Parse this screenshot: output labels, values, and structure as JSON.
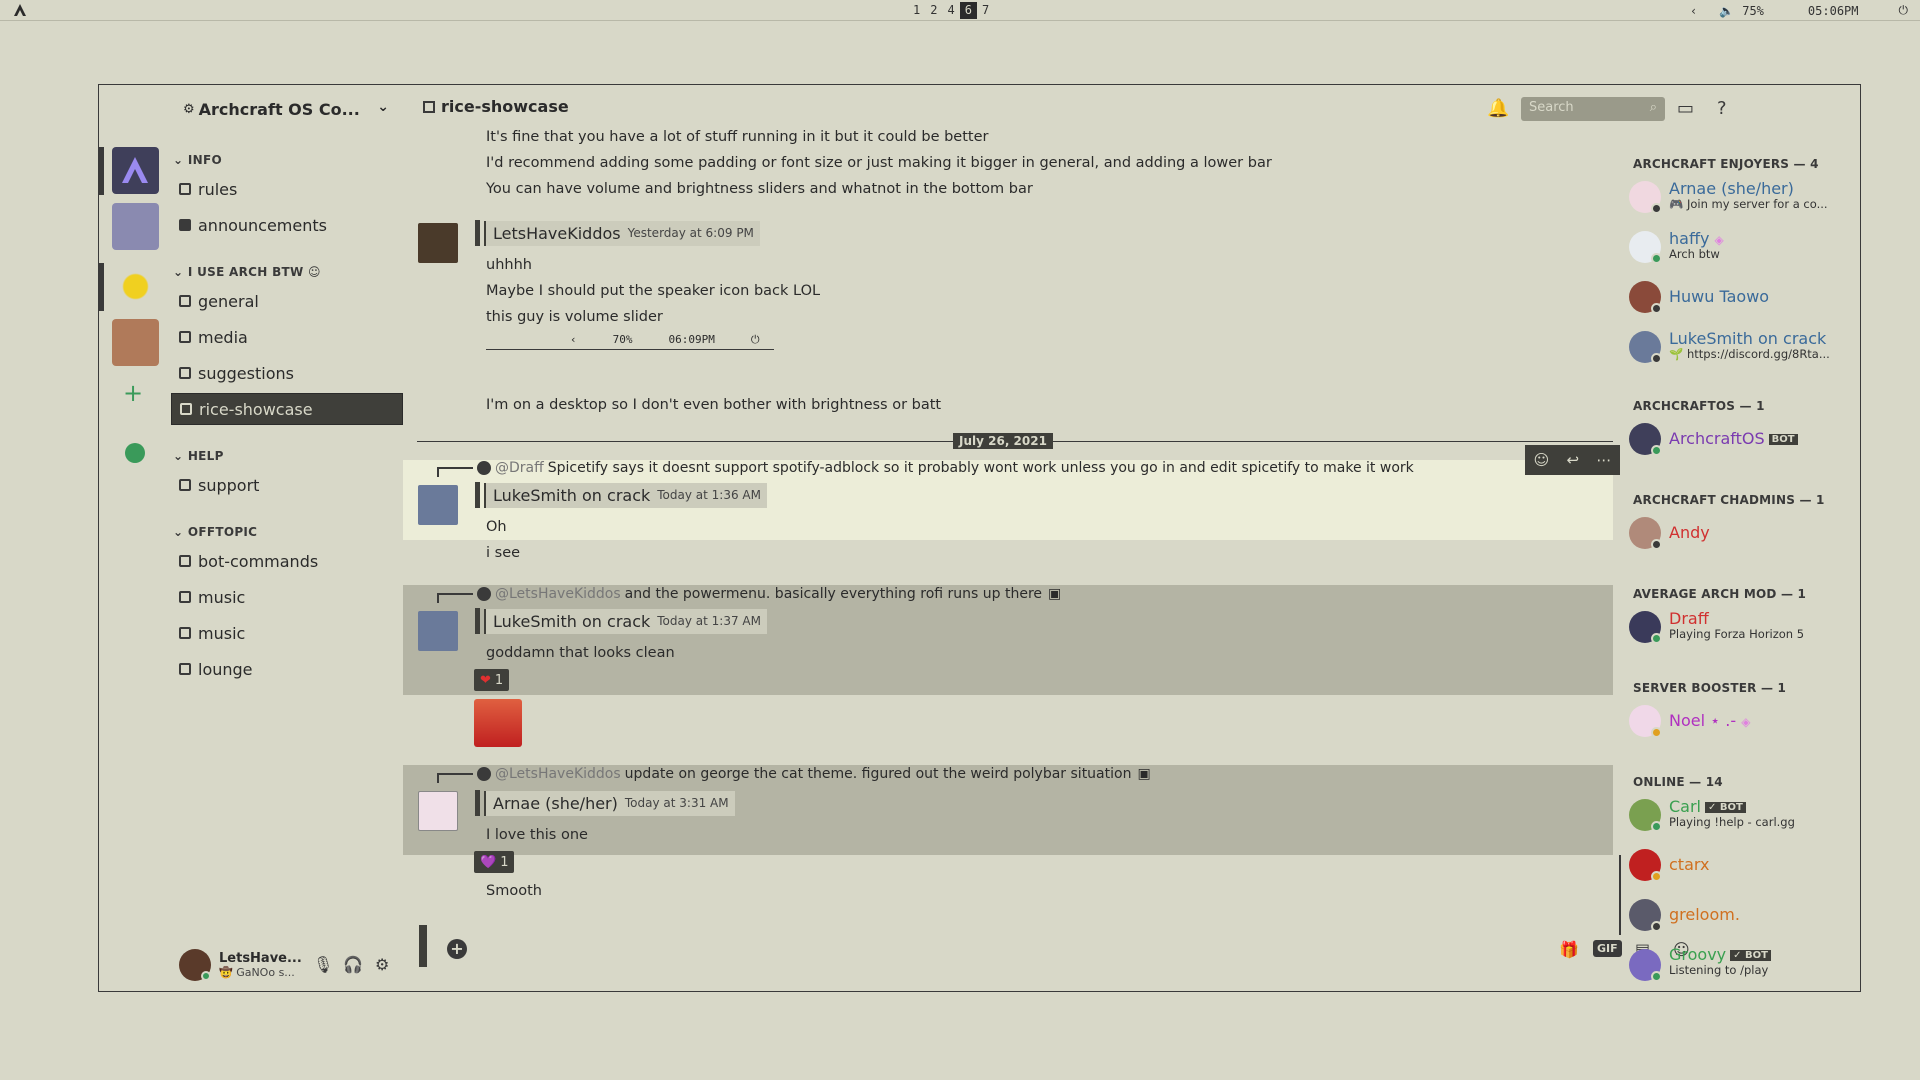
{
  "colors": {
    "background": "#d8d8c8",
    "dark": "#3f3f3a",
    "highlight": "#ecedd8",
    "selected_msg": "#b4b4a4",
    "online": "#3a9a5a",
    "idle": "#e0a020",
    "dnd": "#d03030"
  },
  "topbar": {
    "workspaces": [
      "1",
      "2",
      "4",
      "6",
      "7"
    ],
    "active_workspace": "6",
    "back_icon": "chevron-left-icon",
    "volume_icon": "speaker-icon",
    "volume": "75%",
    "time": "05:06PM",
    "power_icon": "power-icon"
  },
  "server": {
    "name": "Archcraft OS Co...",
    "categories": [
      {
        "label": "INFO"
      },
      {
        "label": "I USE ARCH BTW ☺"
      },
      {
        "label": "HELP"
      },
      {
        "label": "OFFTOPIC"
      }
    ],
    "channels": [
      {
        "label": "rules"
      },
      {
        "label": "announcements"
      },
      {
        "label": "general"
      },
      {
        "label": "media"
      },
      {
        "label": "suggestions"
      },
      {
        "label": "rice-showcase"
      },
      {
        "label": "support"
      },
      {
        "label": "bot-commands"
      },
      {
        "label": "music"
      },
      {
        "label": "music"
      },
      {
        "label": "lounge"
      }
    ]
  },
  "user": {
    "name": "LetsHave...",
    "status": "🤠 GaNOo s..."
  },
  "chat": {
    "channel": "rice-showcase",
    "search_placeholder": "Search",
    "date_divider": "July 26, 2021",
    "messages": [
      {
        "text": "It's fine that you have a lot of stuff running in it but it could be better"
      },
      {
        "text": "I'd recommend adding some padding or font size or just making it bigger in general, and adding a lower bar"
      },
      {
        "text": "You can have volume and brightness sliders and whatnot in the bottom bar"
      },
      {
        "author": "LetsHaveKiddos",
        "time": "Yesterday at 6:09 PM"
      },
      {
        "text": "uhhhh"
      },
      {
        "text": "Maybe I should put the speaker icon back LOL"
      },
      {
        "text": "this guy is volume slider"
      },
      {
        "text": "I'm on a desktop so I don't even bother with brightness or batt"
      }
    ],
    "embedded_bar": {
      "arrow": "‹",
      "volume": "70%",
      "time": "06:09PM",
      "power": "⏻"
    },
    "thread1": {
      "reply_mention": "@Draff",
      "reply_text": "Spicetify says it doesnt support spotify-adblock so it probably wont work unless you go in and edit spicetify to make it work",
      "author": "LukeSmith on crack",
      "time": "Today at 1:36 AM",
      "lines": [
        "Oh",
        "i see"
      ]
    },
    "thread2": {
      "reply_mention": "@LetsHaveKiddos",
      "reply_text": "and the powermenu. basically everything rofi runs up there",
      "author": "LukeSmith on crack",
      "time": "Today at 1:37 AM",
      "lines": [
        "goddamn that looks clean"
      ],
      "reaction": {
        "emoji": "❤",
        "count": "1"
      }
    },
    "thread3": {
      "reply_mention": "@LetsHaveKiddos",
      "reply_text": "update on george the cat theme. figured out the weird polybar situation",
      "author": "Arnae (she/her)",
      "time": "Today at 3:31 AM",
      "lines": [
        "I love this one",
        "Smooth"
      ],
      "reaction": {
        "emoji": "💜",
        "count": "1"
      }
    },
    "composer": {
      "gif_label": "GIF"
    }
  },
  "members": {
    "groups": [
      {
        "label": "ARCHCRAFT ENJOYERS — 4"
      },
      {
        "label": "ARCHCRAFTOS — 1"
      },
      {
        "label": "ARCHCRAFT CHADMINS — 1"
      },
      {
        "label": "AVERAGE ARCH MOD — 1"
      },
      {
        "label": "SERVER BOOSTER — 1"
      },
      {
        "label": "ONLINE — 14"
      }
    ],
    "list": [
      {
        "name": "Arnae (she/her)",
        "sub": "🎮 Join my server for a co...",
        "color": "#3a6a9a"
      },
      {
        "name": "haffy",
        "sub": "Arch btw",
        "color": "#3a6a9a"
      },
      {
        "name": "Huwu Taowo",
        "sub": "",
        "color": "#3a6a9a"
      },
      {
        "name": "LukeSmith on crack",
        "sub": "🌱 https://discord.gg/8Rta...",
        "color": "#3a6a9a"
      },
      {
        "name": "ArchcraftOS",
        "sub": "",
        "color": "#7a3ab0",
        "bot": "BOT"
      },
      {
        "name": "Andy",
        "sub": "",
        "color": "#d03030"
      },
      {
        "name": "Draff",
        "sub": "Playing Forza Horizon 5",
        "color": "#d03030"
      },
      {
        "name": "Noel ⋆ .-",
        "sub": "",
        "color": "#b030c0"
      },
      {
        "name": "Carl",
        "sub": "Playing !help - carl.gg",
        "color": "#3aa050",
        "bot": "✓ BOT"
      },
      {
        "name": "ctarx",
        "sub": "",
        "color": "#d07020"
      },
      {
        "name": "greloom.",
        "sub": "",
        "color": "#d07020"
      },
      {
        "name": "Groovy",
        "sub": "Listening to /play",
        "color": "#3aa050",
        "bot": "✓ BOT"
      }
    ]
  }
}
